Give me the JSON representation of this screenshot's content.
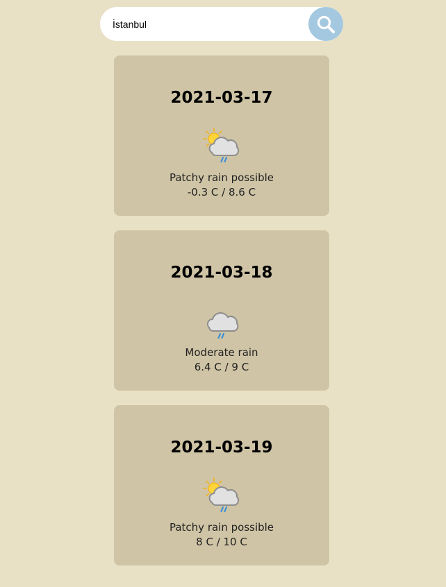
{
  "search": {
    "value": "İstanbul",
    "icon": "search-icon"
  },
  "forecast": [
    {
      "date": "2021-03-17",
      "icon": "sun-cloud-rain-icon",
      "condition": "Patchy rain possible",
      "temperature": "-0.3 C / 8.6 C"
    },
    {
      "date": "2021-03-18",
      "icon": "cloud-rain-icon",
      "condition": "Moderate rain",
      "temperature": "6.4 C / 9 C"
    },
    {
      "date": "2021-03-19",
      "icon": "sun-cloud-rain-icon",
      "condition": "Patchy rain possible",
      "temperature": "8 C / 10 C"
    }
  ],
  "colors": {
    "background": "#e9e1c5",
    "card": "#cfc4a5",
    "search_button": "#a4c8df"
  }
}
